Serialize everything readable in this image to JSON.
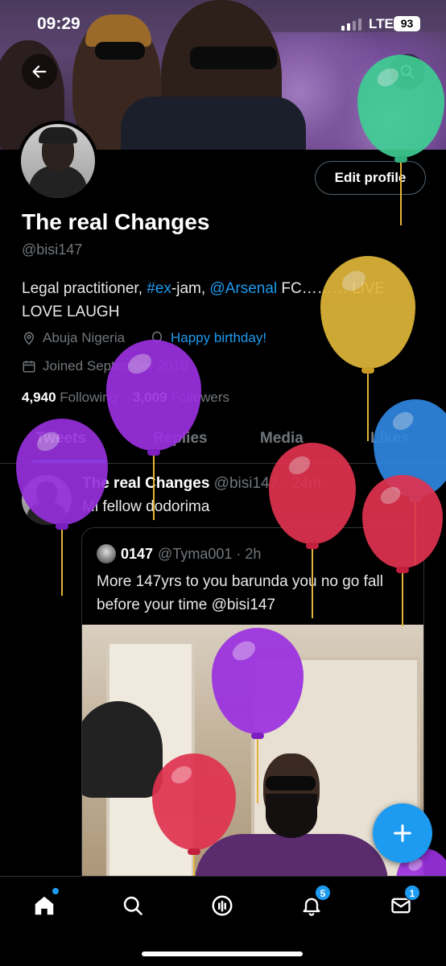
{
  "status_bar": {
    "time": "09:29",
    "network": "LTE",
    "battery": "93"
  },
  "profile": {
    "name": "The real Changes",
    "handle": "@bisi147",
    "edit_button": "Edit profile",
    "bio": {
      "part1": "Legal practitioner, ",
      "hashtag": "#ex",
      "part2": "-jam, ",
      "mention": "@Arsenal",
      "part3": " FC……… LIVE LOVE LAUGH"
    },
    "location": "Abuja Nigeria",
    "birthday": "Happy birthday!",
    "joined": "Joined September 2010",
    "following_count": "4,940",
    "following_label": "Following",
    "followers_count": "3,009",
    "followers_label": "Followers"
  },
  "tabs": [
    {
      "label": "Tweets",
      "active": true
    },
    {
      "label": "Replies",
      "active": false
    },
    {
      "label": "Media",
      "active": false
    },
    {
      "label": "Likes",
      "active": false
    }
  ],
  "tweet": {
    "author": "The real Changes",
    "meta": "@bisi147 · 24m",
    "text": "Mi fellow dodorima",
    "quote": {
      "author": "0147",
      "meta": "@Tyma001 · 2h",
      "text": "More 147yrs to you barunda you no go fall before your time @bisi147"
    }
  },
  "bottom_nav": {
    "notifications_badge": "5",
    "messages_badge": "1"
  },
  "colors": {
    "accent": "#1d9bf0",
    "background": "#000000",
    "secondary_text": "#71767b"
  }
}
